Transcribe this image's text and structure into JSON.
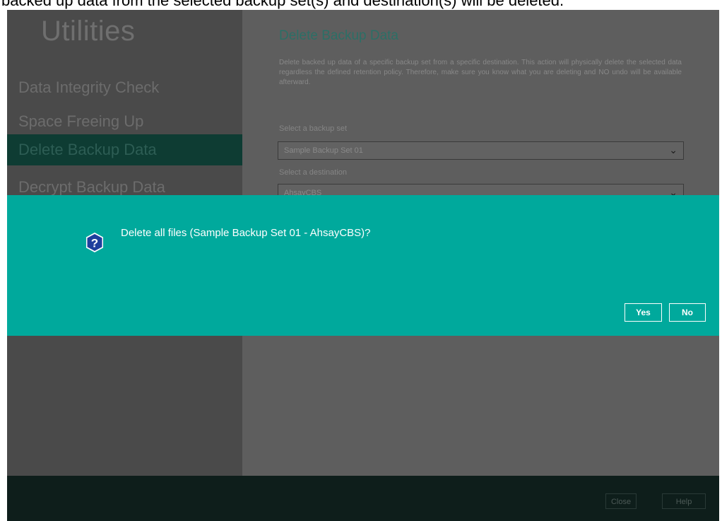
{
  "caption": "backed up data from the selected backup set(s) and destination(s) will be deleted.",
  "sidebar": {
    "title": "Utilities",
    "items": [
      {
        "label": "Data Integrity Check"
      },
      {
        "label": "Space Freeing Up"
      },
      {
        "label": "Delete Backup Data"
      },
      {
        "label": "Decrypt Backup Data"
      }
    ]
  },
  "main": {
    "heading": "Delete Backup Data",
    "description": "Delete backed up data of a specific backup set from a specific destination. This action will physically delete the selected data regardless the defined retention policy. Therefore, make sure you know what you are deleting and NO undo will be available afterward.",
    "backup_set_label": "Select a backup set",
    "backup_set_value": "Sample Backup Set 01",
    "destination_label": "Select a destination",
    "destination_value": "AhsayCBS"
  },
  "dialog": {
    "message": "Delete all files (Sample Backup Set 01 - AhsayCBS)?",
    "icon": "question-icon",
    "yes_label": "Yes",
    "no_label": "No",
    "background": "#00a99c"
  },
  "footer": {
    "close_label": "Close",
    "help_label": "Help"
  }
}
